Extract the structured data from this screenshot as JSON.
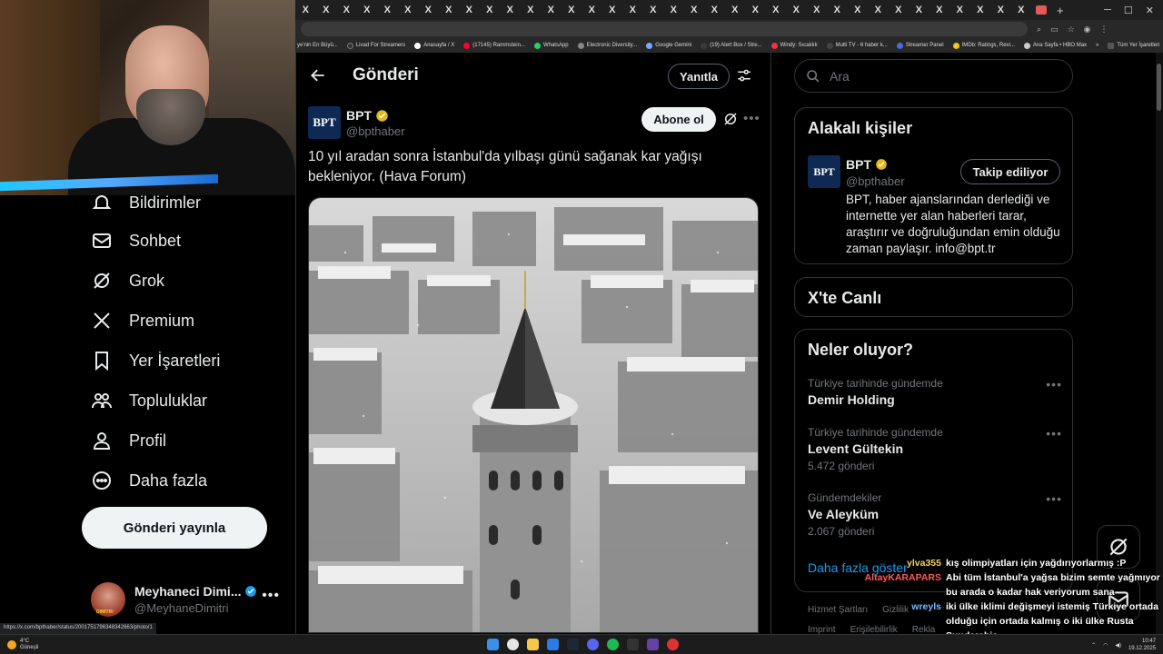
{
  "browser": {
    "bookmarks": [
      "ye'nin En Büyü...",
      "Livad For Streamers",
      "Anasayfa / X",
      "(17145) Rammstein...",
      "WhatsApp",
      "Electronic Diversity...",
      "Google Gemini",
      "(19) Alert Box / Stre...",
      "Windy: Sıcaklık",
      "Multi TV - 6 haber k...",
      "Streamer Panel",
      "IMDb: Ratings, Revi...",
      "Ana Sayfa • HBO Max",
      "Tüm Yer İşaretleri"
    ]
  },
  "sidebar": {
    "items": [
      {
        "label": "Bildirimler",
        "icon": "bell-icon"
      },
      {
        "label": "Sohbet",
        "icon": "mail-icon"
      },
      {
        "label": "Grok",
        "icon": "grok-icon"
      },
      {
        "label": "Premium",
        "icon": "x-logo-icon"
      },
      {
        "label": "Yer İşaretleri",
        "icon": "bookmark-icon"
      },
      {
        "label": "Topluluklar",
        "icon": "communities-icon"
      },
      {
        "label": "Profil",
        "icon": "person-icon"
      },
      {
        "label": "Daha fazla",
        "icon": "more-circle-icon"
      }
    ],
    "post_button": "Gönderi yayınla",
    "profile": {
      "name": "Meyhaneci Dimi...",
      "handle": "@MeyhaneDimitri",
      "avatar_text": "DIMITRI"
    }
  },
  "status_url": "https://x.com/bpthaber/status/2001751796348342663/photo/1",
  "main": {
    "header_title": "Gönderi",
    "reply_button": "Yanıtla",
    "tweet": {
      "avatar_text": "BPT",
      "name": "BPT",
      "handle": "@bpthaber",
      "follow_button": "Abone ol",
      "text": "10 yıl aradan sonra İstanbul'da yılbaşı günü sağanak kar yağışı bekleniyor. (Hava Forum)"
    }
  },
  "right": {
    "search_placeholder": "Ara",
    "related_title": "Alakalı kişiler",
    "related": {
      "avatar_text": "BPT",
      "name": "BPT",
      "handle": "@bpthaber",
      "button": "Takip ediliyor",
      "bio": "BPT, haber ajanslarından derlediği ve internette yer alan haberleri tarar, araştırır ve doğruluğundan emin olduğu zaman paylaşır. info@bpt.tr"
    },
    "live_title": "X'te Canlı",
    "trends_title": "Neler oluyor?",
    "trends": [
      {
        "context": "Türkiye tarihinde gündemde",
        "name": "Demir Holding",
        "count": ""
      },
      {
        "context": "Türkiye tarihinde gündemde",
        "name": "Levent Gültekin",
        "count": "5.472 gönderi"
      },
      {
        "context": "Gündemdekiler",
        "name": "Ve Aleyküm",
        "count": "2.067 gönderi"
      }
    ],
    "show_more": "Daha fazla göster",
    "footer1": [
      "Hizmet Şartları",
      "Gizlilik"
    ],
    "footer2": [
      "Imprint",
      "Erişilebilirlik",
      "Rekla"
    ]
  },
  "chat": [
    {
      "user": "ylva355",
      "user_color": "#f0d060",
      "msg": "kış olimpiyatları için yağdırıyorlarmış :P"
    },
    {
      "user": "AltayKARAPARS",
      "user_color": "#ff5a5a",
      "msg": "Abi tüm İstanbul'a yağsa bizim semte yağmıyor"
    },
    {
      "user": "",
      "user_color": "#ffffff",
      "msg": "bu arada o kadar hak veriyorum sana"
    },
    {
      "user": "wreyls",
      "user_color": "#7ab8ff",
      "msg": "iki ülke iklimi değişmeyi istemiş Türkiye ortada"
    },
    {
      "user": "",
      "user_color": "#ffffff",
      "msg": "olduğu için ortada kalmış o iki ülke Rusta"
    },
    {
      "user": "",
      "user_color": "#ffffff",
      "msg": "Suudarabia"
    }
  ],
  "taskbar": {
    "weather_temp": "4°C",
    "weather_desc": "Güneşli",
    "time": "10:47",
    "date": "19.12.2025"
  }
}
